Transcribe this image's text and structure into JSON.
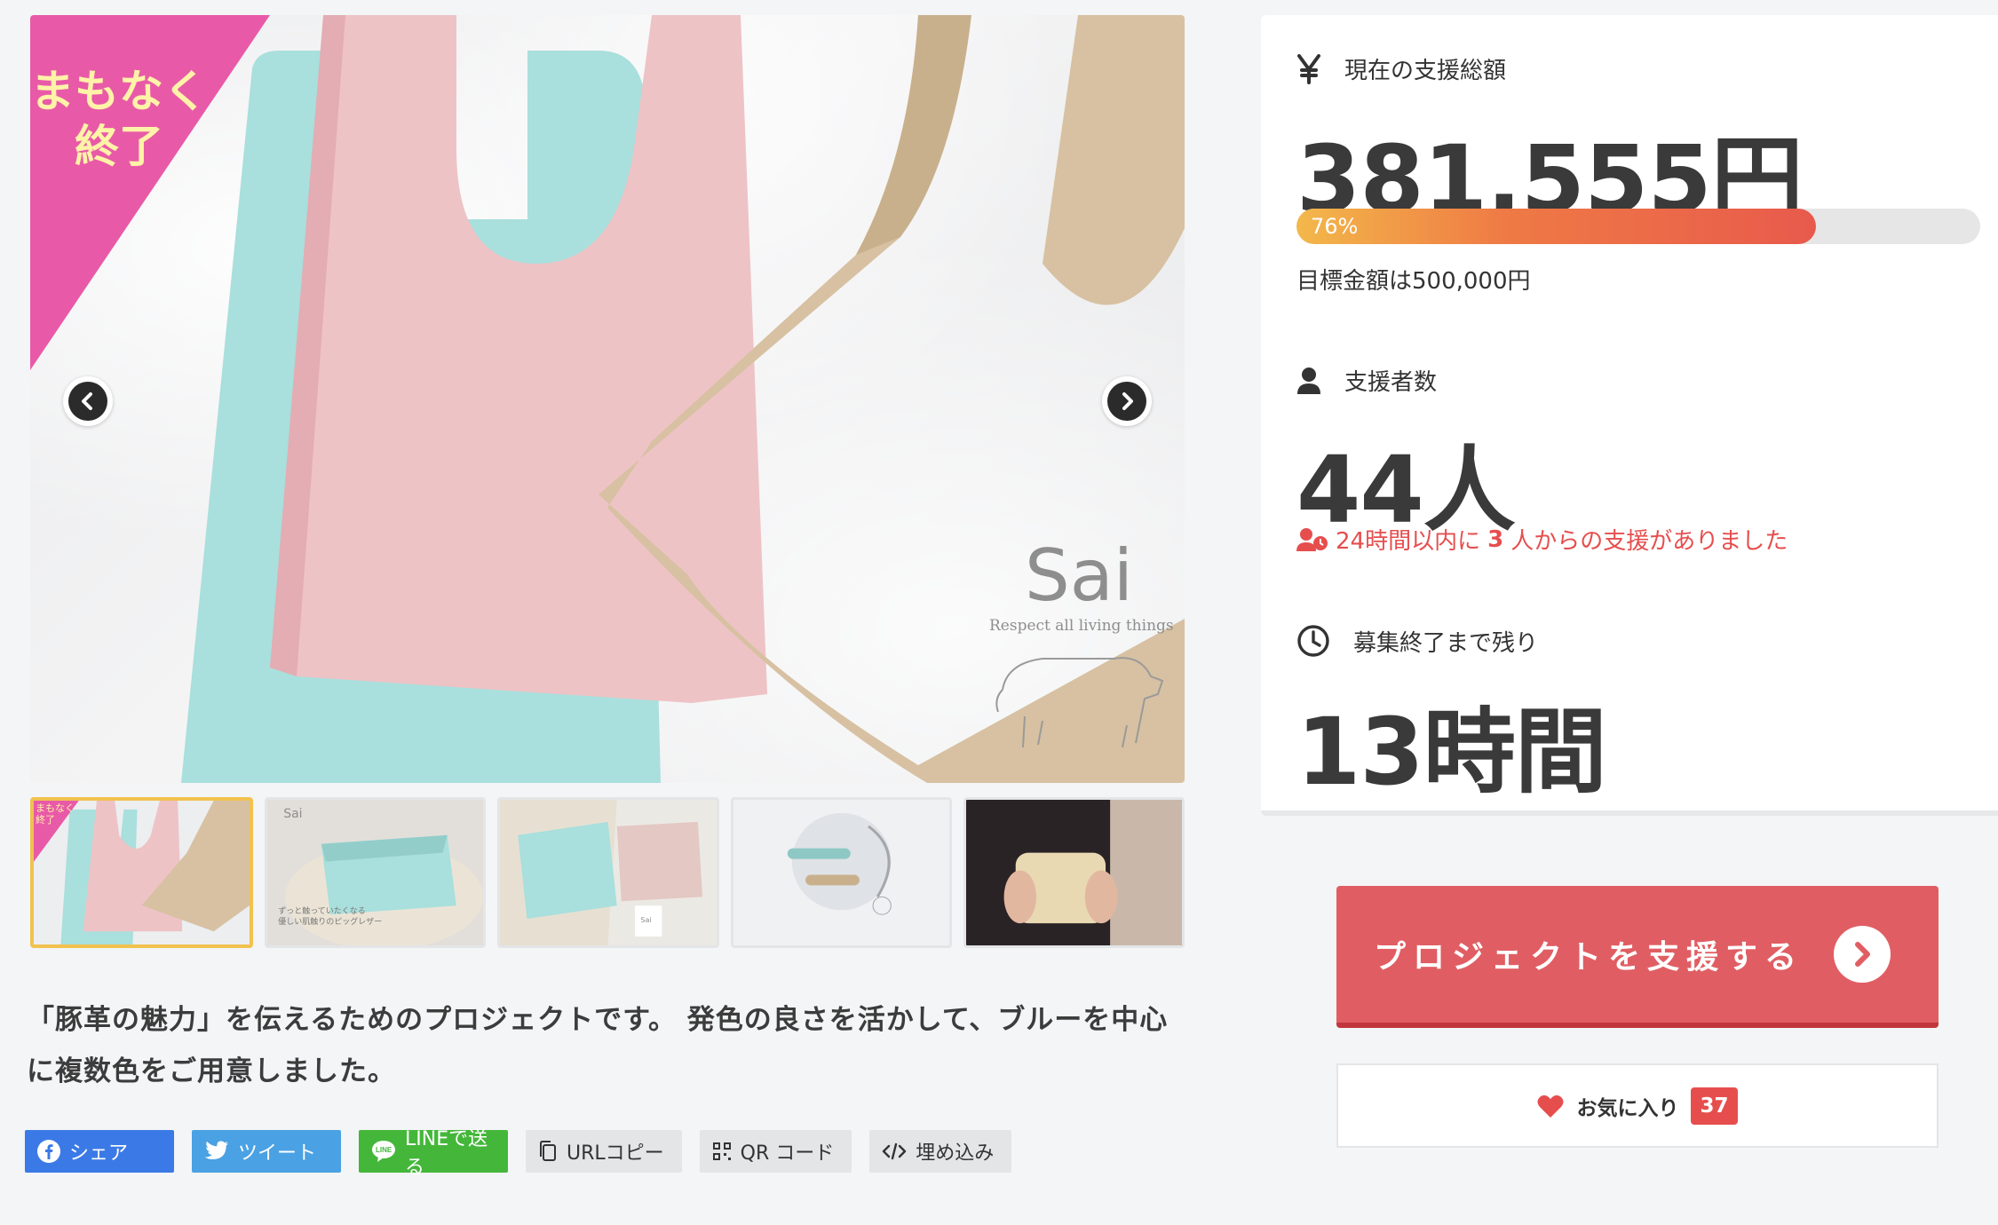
{
  "hero": {
    "ribbon_line1": "まもなく",
    "ribbon_line2": "終了",
    "brand": "Sai",
    "brand_tagline": "Respect all living things",
    "thumb_ribbon": "まもなく\n終了",
    "thumb2_brand": "Sai",
    "thumb2_caption": "ずっと触っていたくなる\n優しい肌触りのピッグレザー",
    "thumb3_brand": "Sai"
  },
  "description": "「豚革の魅力」を伝えるためのプロジェクトです。 発色の良さを活かして、ブルーを中心に複数色をご用意しました。",
  "share": {
    "facebook": "シェア",
    "twitter": "ツイート",
    "line": "LINEで送る",
    "url_copy": "URLコピー",
    "qr": "QR コード",
    "embed": "埋め込み"
  },
  "stats": {
    "total_label": "現在の支援総額",
    "total_amount": "381,555円",
    "progress_fraction": 0.76,
    "progress_label": "76%",
    "goal": "目標金額は500,000円",
    "backers_label": "支援者数",
    "backers_count": "44人",
    "recent_prefix": "24時間以内に",
    "recent_count": "3",
    "recent_suffix": "人からの支援がありました",
    "remaining_label": "募集終了まで残り",
    "remaining_value": "13時間"
  },
  "cta": {
    "support_label": "プロジェクトを支援する",
    "favorite_label": "お気に入り",
    "favorite_count": "37"
  },
  "icons": {
    "currency": "yen-icon",
    "backers": "user-icon",
    "recent": "user-clock-icon",
    "remaining": "clock-icon",
    "favorite": "heart-icon"
  },
  "colors": {
    "accent_red": "#e05e63",
    "progress_start": "#f3b84a",
    "progress_end": "#e85a4c",
    "ribbon_pink": "#e85aa8",
    "facebook": "#3b7ae6",
    "twitter": "#4aa1e3",
    "line": "#44b73a"
  }
}
